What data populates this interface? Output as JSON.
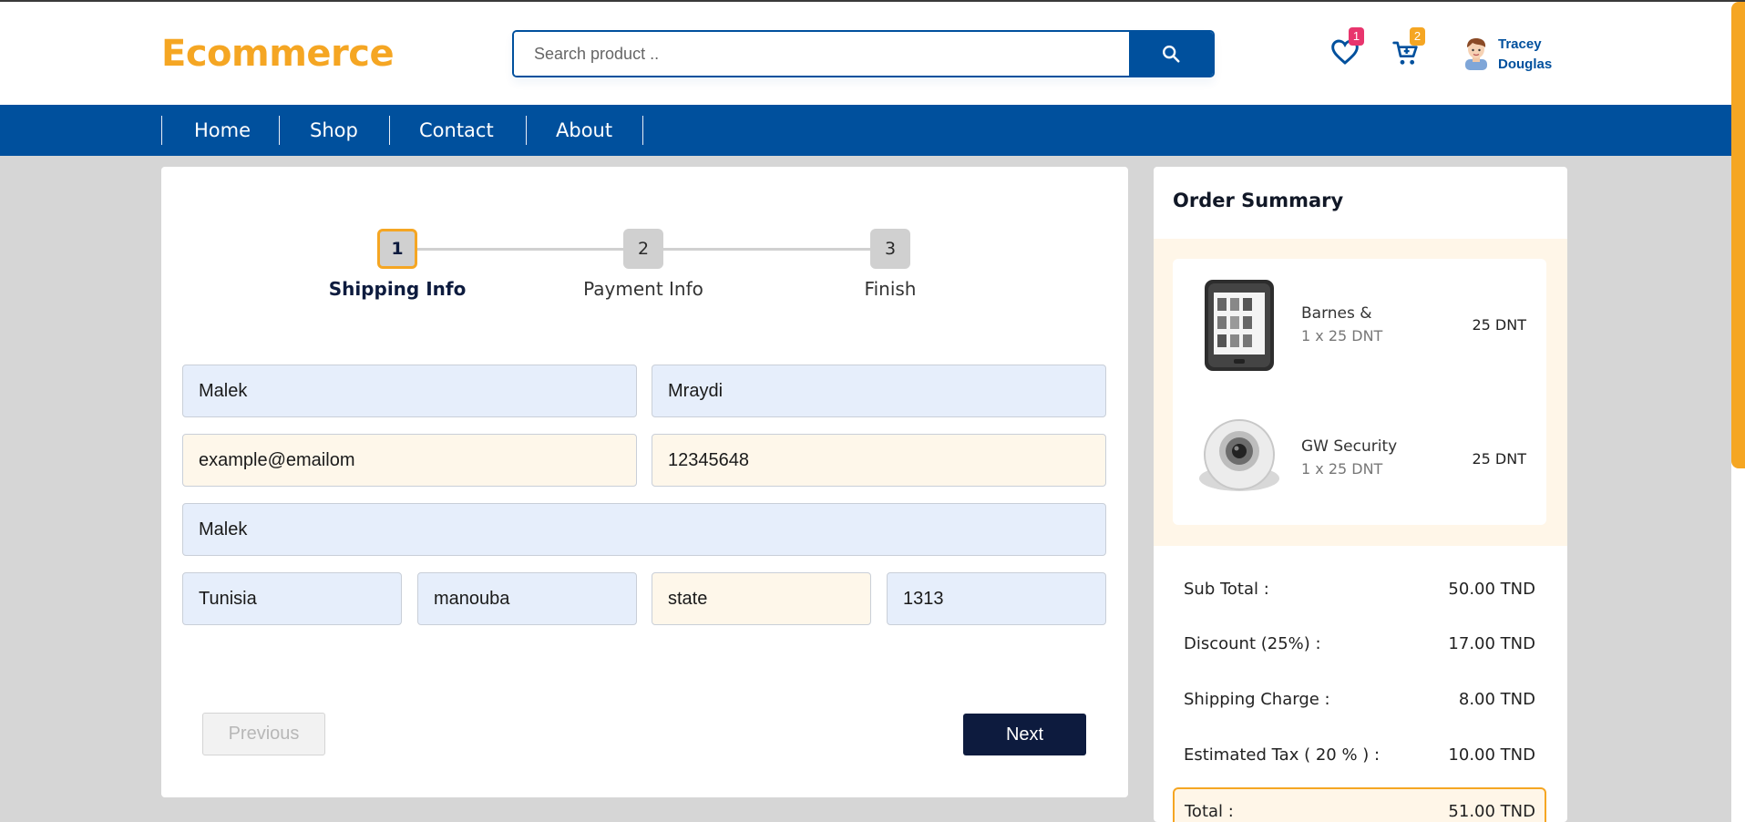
{
  "header": {
    "logo": "Ecommerce",
    "search": {
      "placeholder": "Search product .."
    },
    "wishlist_count": "1",
    "cart_count": "2",
    "user": {
      "first_name": "Tracey",
      "last_name": "Douglas"
    }
  },
  "nav": {
    "items": [
      "Home",
      "Shop",
      "Contact",
      "About"
    ]
  },
  "steps": [
    {
      "number": "1",
      "label": "Shipping Info",
      "active": true
    },
    {
      "number": "2",
      "label": "Payment Info",
      "active": false
    },
    {
      "number": "3",
      "label": "Finish",
      "active": false
    }
  ],
  "form": {
    "first_name": "Malek",
    "last_name": "Mraydi",
    "email": "example@emailom",
    "phone": "12345648",
    "address": "Malek",
    "country": "Tunisia",
    "city": "manouba",
    "state": "state",
    "zip": "1313"
  },
  "buttons": {
    "previous": "Previous",
    "next": "Next"
  },
  "summary": {
    "title": "Order Summary",
    "items": [
      {
        "name": "Barnes &",
        "qty": "1 x 25 DNT",
        "price": "25 DNT",
        "icon": "ereader-image"
      },
      {
        "name": "GW Security",
        "qty": "1 x 25 DNT",
        "price": "25 DNT",
        "icon": "dome-camera-image"
      }
    ],
    "rows": [
      {
        "label": "Sub Total :",
        "value": "50.00 TND"
      },
      {
        "label": "Discount (25%) :",
        "value": "17.00 TND"
      },
      {
        "label": "Shipping Charge :",
        "value": "8.00 TND"
      },
      {
        "label": "Estimated Tax ( 20 % ) :",
        "value": "10.00 TND"
      }
    ],
    "total": {
      "label": "Total :",
      "value": "51.00 TND"
    }
  },
  "colors": {
    "brand_blue": "#00509d",
    "accent_orange": "#f5a623",
    "dark_navy": "#0d1b3e"
  }
}
